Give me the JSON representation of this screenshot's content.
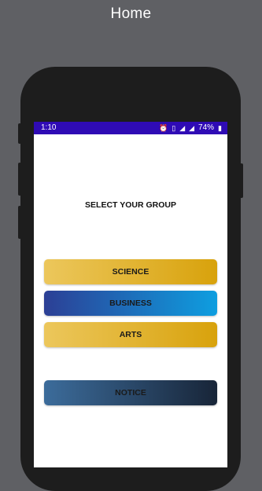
{
  "frame": {
    "title": "Home"
  },
  "status_bar": {
    "time": "1:10",
    "battery": "74%",
    "icons": [
      "alarm-icon",
      "vibrate-icon",
      "signal-icon",
      "signal-icon",
      "battery-icon"
    ]
  },
  "main": {
    "heading": "SELECT YOUR GROUP",
    "buttons": [
      {
        "label": "SCIENCE"
      },
      {
        "label": "BUSINESS"
      },
      {
        "label": "ARTS"
      },
      {
        "label": "NOTICE"
      }
    ]
  },
  "colors": {
    "status_bar": "#2f0bb5",
    "gold_start": "#ecc75c",
    "gold_end": "#d8a20c",
    "blue_start": "#2c3f95",
    "blue_end": "#0e9ee0",
    "notice_start": "#3c6c9b",
    "notice_end": "#182538"
  }
}
